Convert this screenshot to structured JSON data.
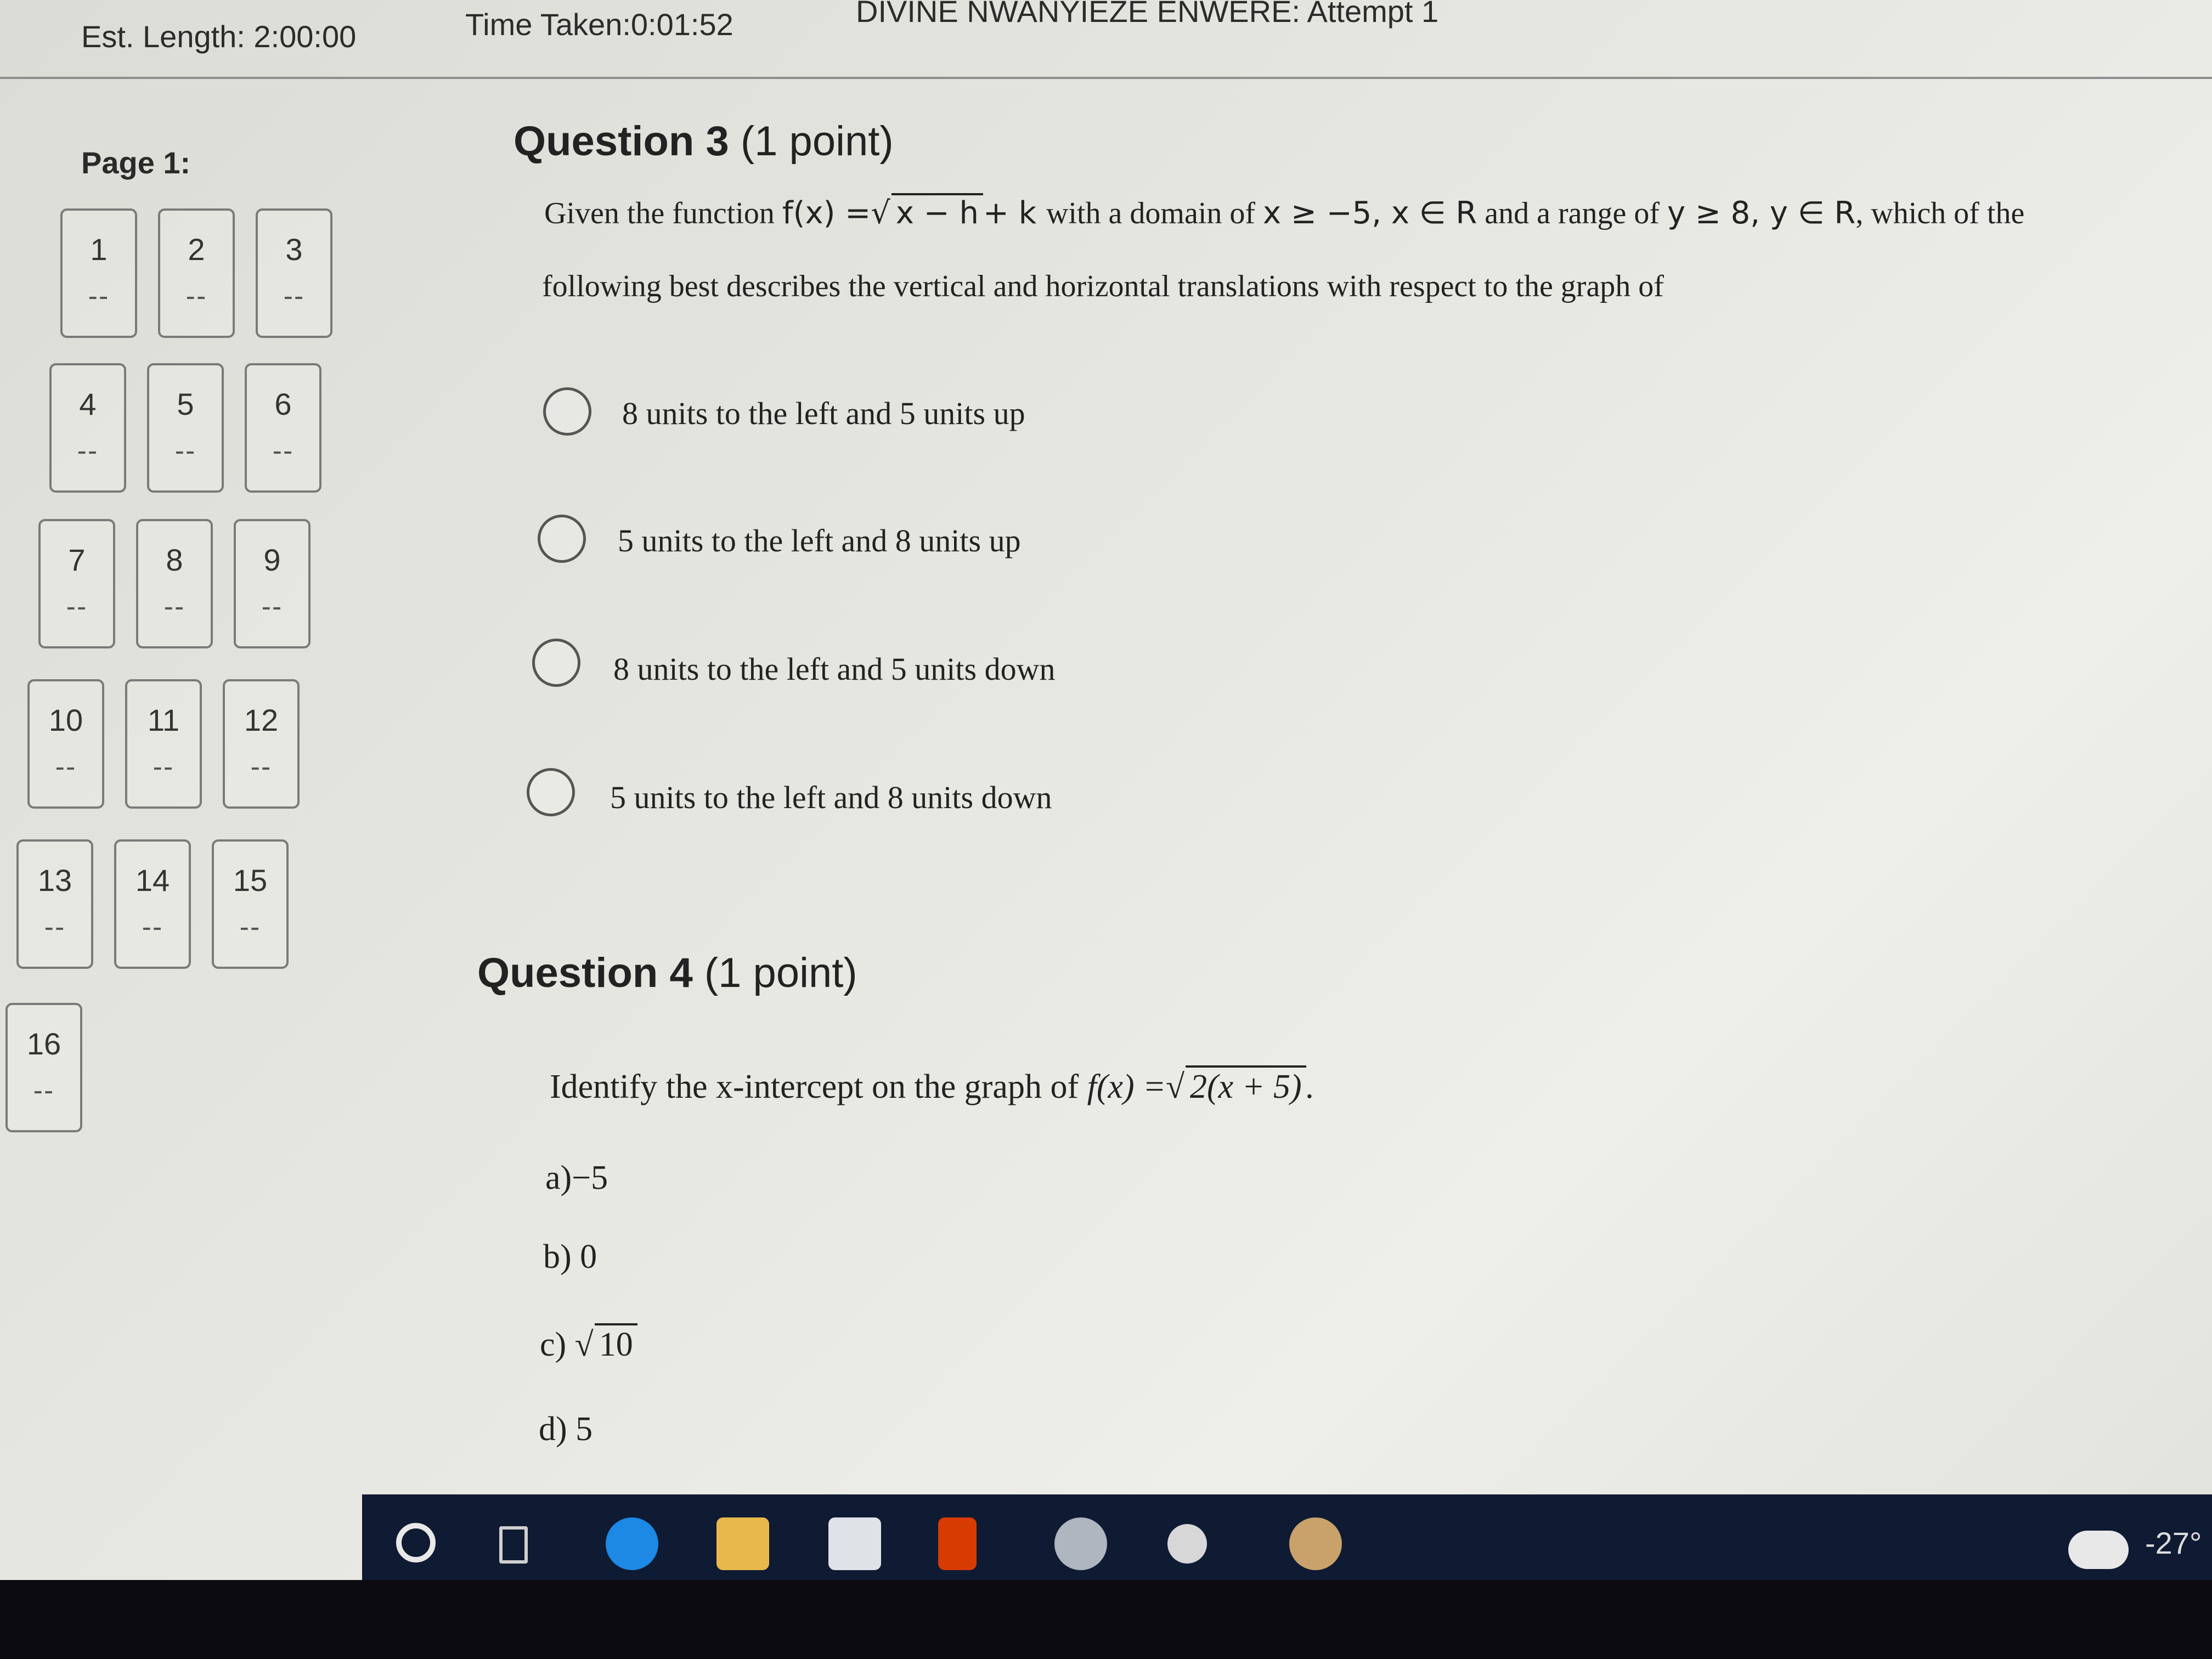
{
  "header": {
    "est_length": "Est. Length: 2:00:00",
    "time_taken": "Time Taken:0:01:52",
    "attempt": "DIVINE NWANYIEZE ENWERE: Attempt 1"
  },
  "nav": {
    "page_label": "Page 1:",
    "questions": [
      {
        "num": "1",
        "status": "--"
      },
      {
        "num": "2",
        "status": "--"
      },
      {
        "num": "3",
        "status": "--"
      },
      {
        "num": "4",
        "status": "--"
      },
      {
        "num": "5",
        "status": "--"
      },
      {
        "num": "6",
        "status": "--"
      },
      {
        "num": "7",
        "status": "--"
      },
      {
        "num": "8",
        "status": "--"
      },
      {
        "num": "9",
        "status": "--"
      },
      {
        "num": "10",
        "status": "--"
      },
      {
        "num": "11",
        "status": "--"
      },
      {
        "num": "12",
        "status": "--"
      },
      {
        "num": "13",
        "status": "--"
      },
      {
        "num": "14",
        "status": "--"
      },
      {
        "num": "15",
        "status": "--"
      },
      {
        "num": "16",
        "status": "--"
      }
    ]
  },
  "q3": {
    "title": "Question 3",
    "points": "(1 point)",
    "text_pre": "Given the function",
    "func": "f(x) = √x − h + k",
    "func_lhs": "f(x) =",
    "func_rad": "x − h",
    "func_tail": "+ k",
    "text_domain": "with a domain of",
    "domain": "x ≥ −5, x ∈ R",
    "text_range": "and a range of",
    "range": "y ≥ 8, y ∈ R",
    "text_post": ", which of the",
    "line2": "following best describes the vertical and horizontal translations with respect to the graph of",
    "options": [
      "8 units to the left and 5 units up",
      "5 units to the left and 8 units up",
      "8 units to the left and 5 units down",
      "5 units to the left and 8 units down"
    ]
  },
  "q4": {
    "title": "Question 4",
    "points": "(1 point)",
    "text": "Identify the x-intercept on the graph of",
    "func_lhs": "f(x) =",
    "func_rad": "2(x + 5)",
    "func_end": ".",
    "choices": [
      {
        "label": "a)",
        "value": "−5"
      },
      {
        "label": "b)",
        "value": "0"
      },
      {
        "label": "c)",
        "sqrt": "10"
      },
      {
        "label": "d)",
        "value": "5"
      }
    ]
  },
  "taskbar": {
    "icons": [
      "search-circle-icon",
      "task-view-icon",
      "edge-icon",
      "file-explorer-icon",
      "store-icon",
      "office-icon",
      "chrome-profile-icon",
      "settings-icon",
      "chrome-icon"
    ],
    "temperature": "-27°"
  }
}
